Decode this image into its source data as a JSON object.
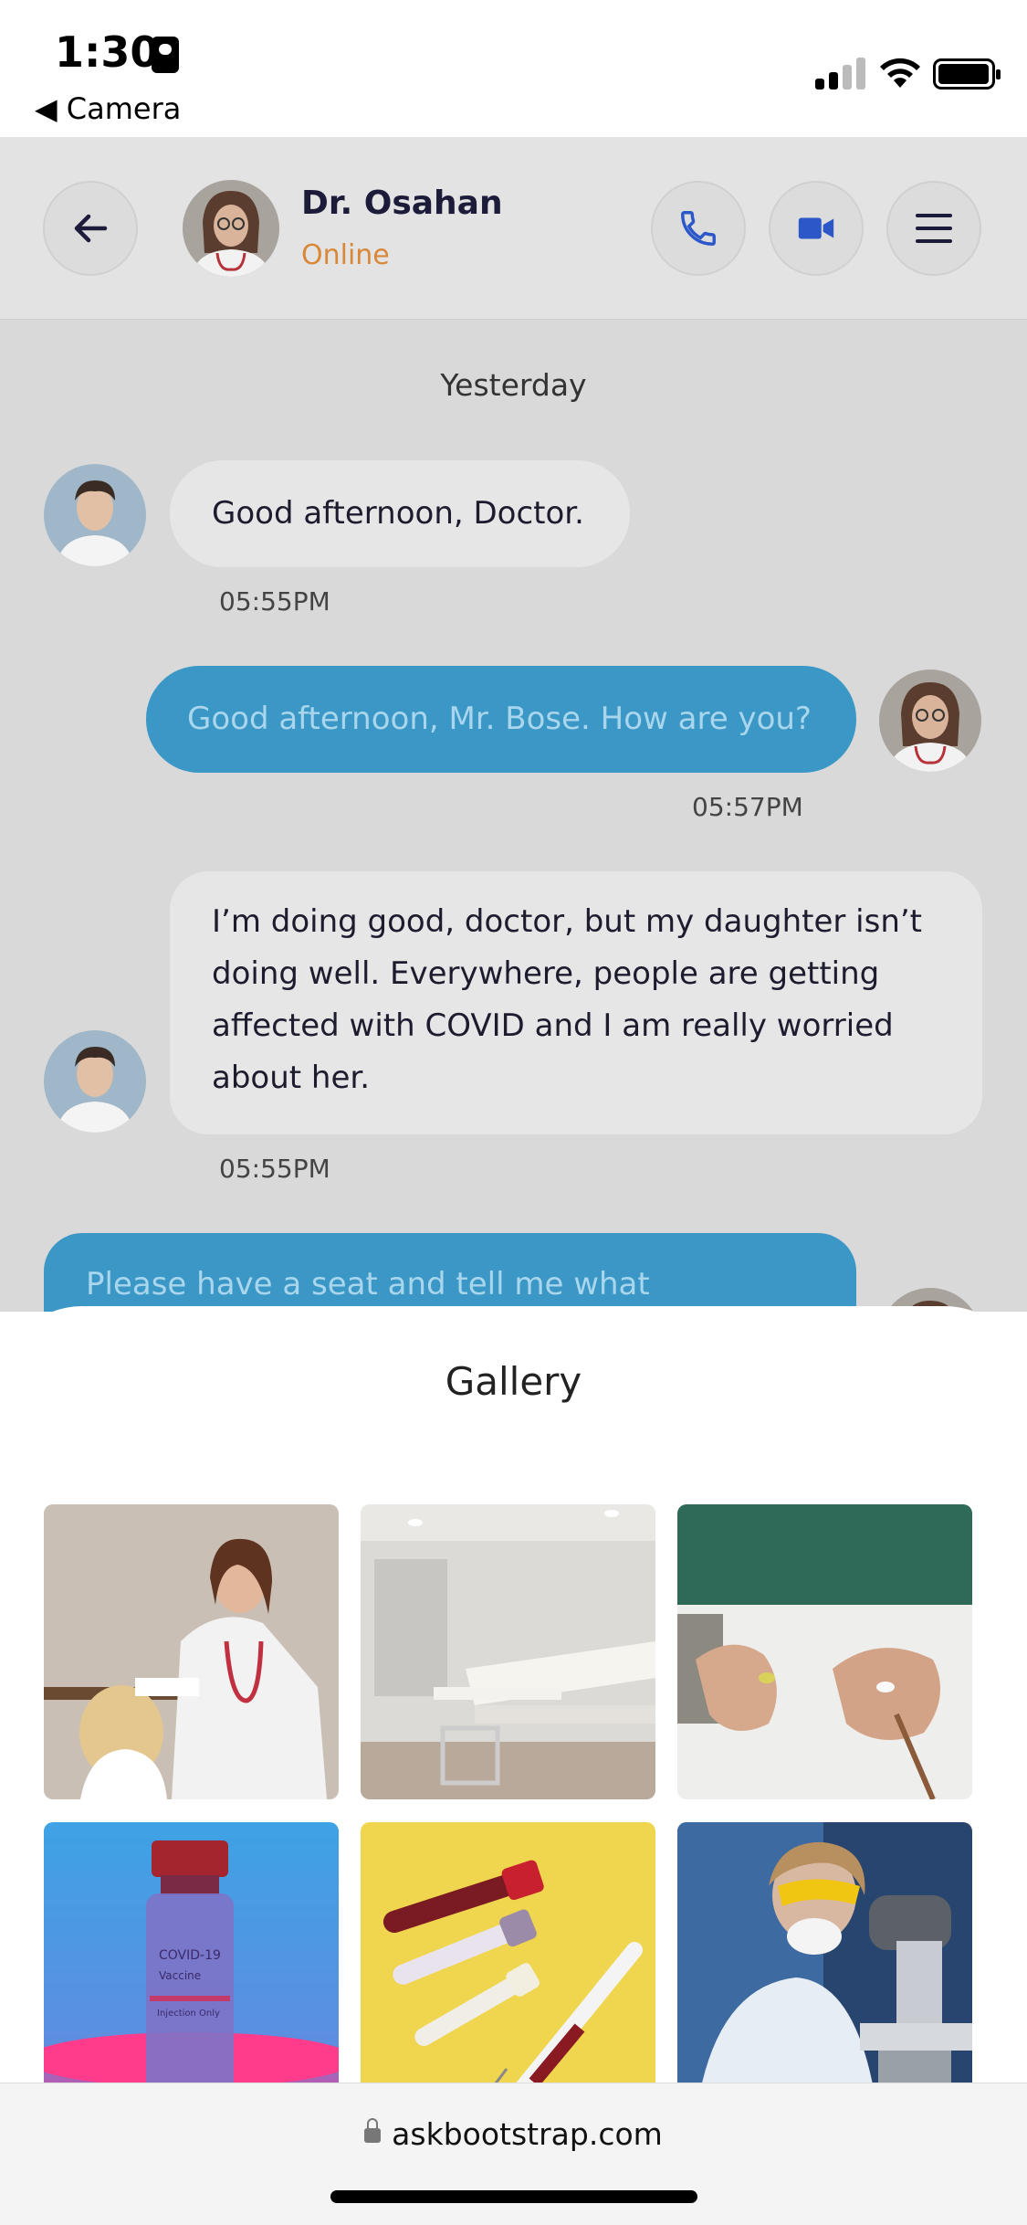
{
  "status_bar": {
    "time": "1:30",
    "back_app": "◀ Camera"
  },
  "chat_header": {
    "doctor_name": "Dr. Osahan",
    "status": "Online",
    "icons": [
      "back-arrow-icon",
      "phone-icon",
      "video-icon",
      "menu-icon"
    ]
  },
  "messages": {
    "day_label": "Yesterday",
    "items": [
      {
        "side": "in",
        "text": "Good afternoon, Doctor.",
        "time": "05:55PM"
      },
      {
        "side": "out",
        "text": "Good afternoon, Mr. Bose. How are you?",
        "time": "05:57PM"
      },
      {
        "side": "in",
        "lines": [
          "I’m doing good, doctor, but my daughter isn’t",
          "doing well. Everywhere, people are getting",
          "affected with COVID and I am really worried",
          "about her."
        ],
        "time": "05:55PM"
      },
      {
        "side": "out",
        "text": "Please have a seat and tell me what"
      }
    ]
  },
  "gallery": {
    "title": "Gallery",
    "images": [
      "doctor-with-child",
      "clinic-room",
      "pills-in-hands",
      "covid-vaccine-vial",
      "blood-test-tubes",
      "lab-microscope"
    ],
    "vial_label": [
      "COVID-19",
      "Vaccine",
      "Injection Only"
    ]
  },
  "browser": {
    "url": "askbootstrap.com"
  },
  "colors": {
    "accent_blue": "#3a97c6",
    "online_orange": "#d9883a",
    "icon_blue": "#2b57c9"
  }
}
